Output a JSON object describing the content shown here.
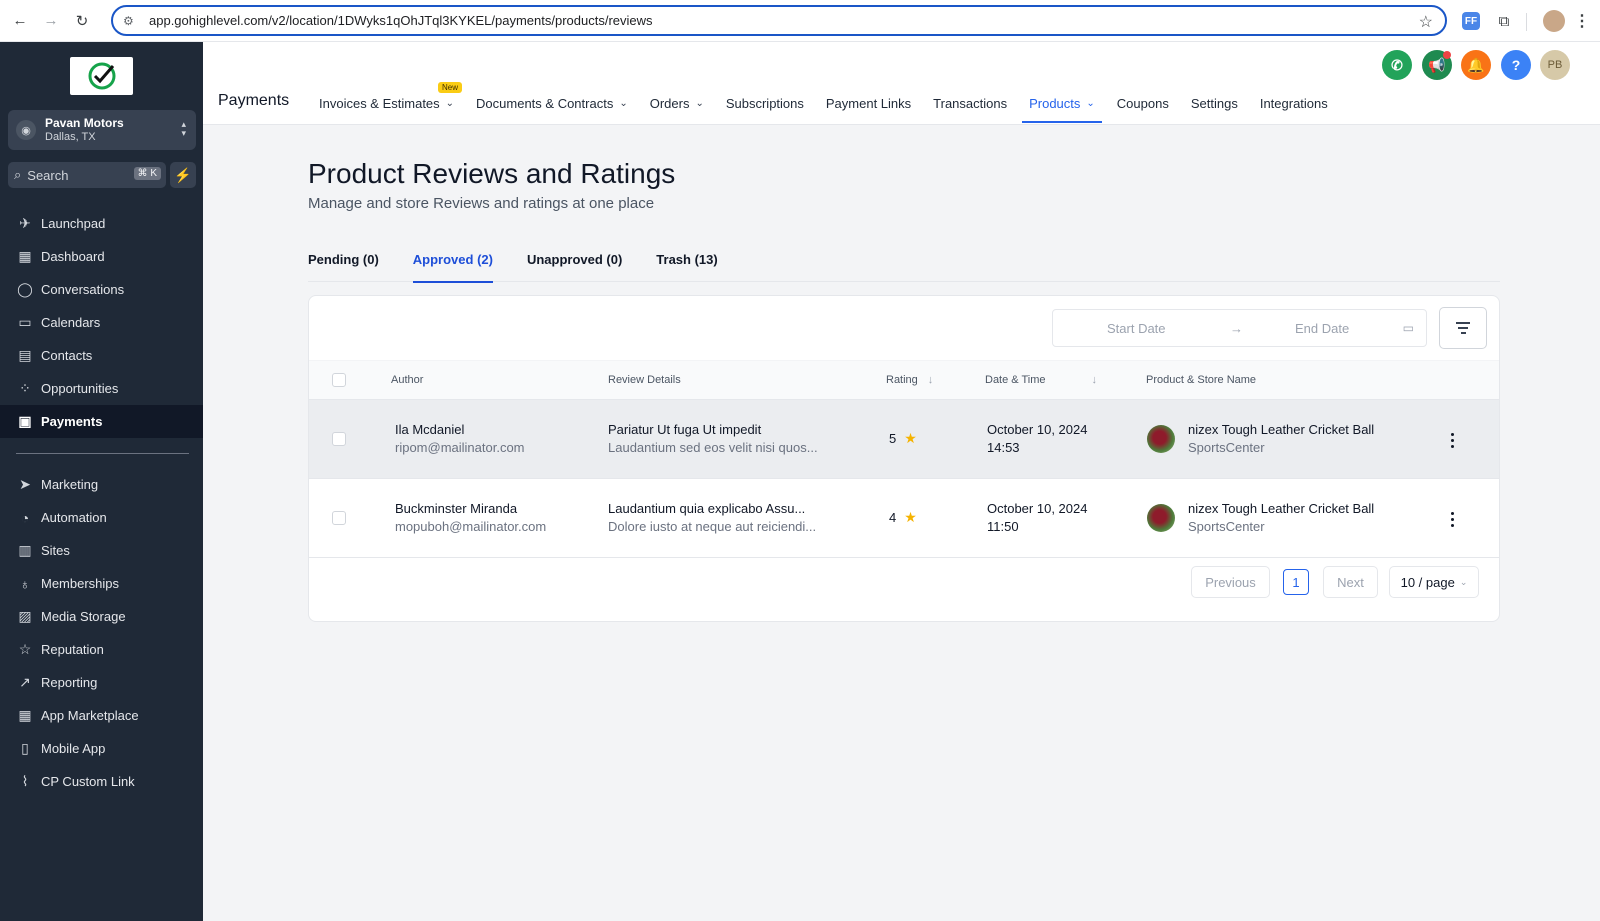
{
  "browser": {
    "url": "app.gohighlevel.com/v2/location/1DWyks1qOhJTql3KYKEL/payments/products/reviews"
  },
  "sidebar": {
    "account": {
      "name": "Pavan Motors",
      "location": "Dallas, TX"
    },
    "search": {
      "placeholder": "Search",
      "shortcut": "⌘ K"
    },
    "items": [
      {
        "label": "Launchpad",
        "icon": "rocket-icon"
      },
      {
        "label": "Dashboard",
        "icon": "grid-icon"
      },
      {
        "label": "Conversations",
        "icon": "chat-icon"
      },
      {
        "label": "Calendars",
        "icon": "calendar-icon"
      },
      {
        "label": "Contacts",
        "icon": "contacts-icon"
      },
      {
        "label": "Opportunities",
        "icon": "opportunities-icon"
      },
      {
        "label": "Payments",
        "icon": "payments-icon",
        "active": true
      }
    ],
    "items2": [
      {
        "label": "Marketing",
        "icon": "send-icon"
      },
      {
        "label": "Automation",
        "icon": "automation-icon"
      },
      {
        "label": "Sites",
        "icon": "sites-icon"
      },
      {
        "label": "Memberships",
        "icon": "membership-icon"
      },
      {
        "label": "Media Storage",
        "icon": "image-icon"
      },
      {
        "label": "Reputation",
        "icon": "star-icon"
      },
      {
        "label": "Reporting",
        "icon": "trend-icon"
      },
      {
        "label": "App Marketplace",
        "icon": "apps-icon"
      },
      {
        "label": "Mobile App",
        "icon": "mobile-icon"
      },
      {
        "label": "CP Custom Link",
        "icon": "link-icon"
      }
    ]
  },
  "header": {
    "title": "Payments",
    "tabs": [
      {
        "label": "Invoices & Estimates",
        "badge": "New",
        "dropdown": true
      },
      {
        "label": "Documents & Contracts",
        "dropdown": true
      },
      {
        "label": "Orders",
        "dropdown": true
      },
      {
        "label": "Subscriptions"
      },
      {
        "label": "Payment Links"
      },
      {
        "label": "Transactions"
      },
      {
        "label": "Products",
        "dropdown": true,
        "active": true
      },
      {
        "label": "Coupons"
      },
      {
        "label": "Settings"
      },
      {
        "label": "Integrations"
      }
    ],
    "avatar_initials": "PB"
  },
  "main": {
    "title": "Product Reviews and Ratings",
    "subtitle": "Manage and store Reviews and ratings at one place",
    "tabs": [
      {
        "label": "Pending (0)"
      },
      {
        "label": "Approved (2)",
        "active": true
      },
      {
        "label": "Unapproved (0)"
      },
      {
        "label": "Trash (13)"
      }
    ],
    "filters": {
      "start_date": "Start Date",
      "end_date": "End Date"
    },
    "columns": {
      "author": "Author",
      "review": "Review Details",
      "rating": "Rating",
      "date": "Date & Time",
      "product": "Product & Store Name"
    },
    "rows": [
      {
        "author": "Ila Mcdaniel",
        "email": "ripom@mailinator.com",
        "review_title": "Pariatur Ut fuga Ut impedit",
        "review_body": "Laudantium sed eos velit nisi quos...",
        "rating": "5",
        "date": "October 10, 2024",
        "time": "14:53",
        "product": "nizex Tough Leather Cricket Ball",
        "store": "SportsCenter"
      },
      {
        "author": "Buckminster Miranda",
        "email": "mopuboh@mailinator.com",
        "review_title": "Laudantium quia explicabo Assu...",
        "review_body": "Dolore iusto at neque aut reiciendi...",
        "rating": "4",
        "date": "October 10, 2024",
        "time": "11:50",
        "product": "nizex Tough Leather Cricket Ball",
        "store": "SportsCenter"
      }
    ],
    "pagination": {
      "previous": "Previous",
      "page": "1",
      "next": "Next",
      "page_size": "10 / page"
    }
  }
}
